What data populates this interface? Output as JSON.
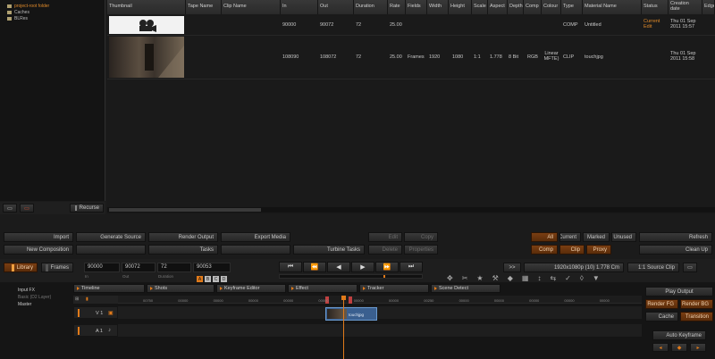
{
  "tree": {
    "items": [
      "project-root folder",
      "Caches",
      "BLRes"
    ]
  },
  "browser": {
    "columns": [
      "Thumbnail",
      "Tape Name",
      "Clip Name",
      "In",
      "Out",
      "Duration",
      "Rate",
      "Fields",
      "Width",
      "Height",
      "Scale",
      "Aspect",
      "Depth",
      "Comp",
      "Colour",
      "Type",
      "Material Name",
      "Status",
      "Creation date",
      "Edge"
    ],
    "rows": [
      {
        "in": "90000",
        "out": "90072",
        "duration": "72",
        "rate": "25.00",
        "fields": "",
        "width": "",
        "height": "",
        "scale": "",
        "aspect": "",
        "depth": "",
        "comp": "",
        "colour": "",
        "type": "COMP",
        "material": "Untitled",
        "status": "Current Edit",
        "created": "Thu 01 Sep 2011 15:57"
      },
      {
        "in": "108090",
        "out": "108072",
        "duration": "72",
        "rate": "25.00",
        "fields": "Frames",
        "width": "1920",
        "height": "1080",
        "scale": "1:1",
        "aspect": "1.778",
        "depth": "8 Bit",
        "comp": "RGB",
        "colour": "Linear MFTE)",
        "type": "CLIP",
        "material": "touchjpg",
        "status": "",
        "created": "Thu 01 Sep 2011 15:58"
      }
    ]
  },
  "tree_buttons": {
    "recurse": "Recurse"
  },
  "actions": {
    "import": "Import",
    "generate_source": "Generate Source",
    "render_output": "Render Output",
    "export_media": "Export Media",
    "new_composition": "New Composition",
    "tasks": "Tasks",
    "turbine_tasks": "Turbine Tasks",
    "edit": "Edit",
    "copy": "Copy",
    "delete": "Delete",
    "properties": "Properties",
    "all": "All",
    "current": "Current",
    "marked": "Marked",
    "unused": "Unused",
    "comp": "Comp",
    "clip": "Clip",
    "proxy": "Proxy",
    "refresh": "Refresh",
    "clean_up": "Clean Up"
  },
  "transport_bar": {
    "library": "Library",
    "frames": "Frames",
    "in_value": "90000",
    "out_value": "90072",
    "duration_value": "72",
    "position_value": "90053",
    "in_label": "In",
    "out_label": "Out",
    "duration_label": "Duration",
    "expand": ">>",
    "format": "1920x1080p (10) 1.778 Cm",
    "source_clip": "1:1 Source Clip",
    "icons": [
      "skip-start-icon",
      "step-back-icon",
      "play-reverse-icon",
      "play-icon",
      "step-forward-icon",
      "skip-end-icon"
    ],
    "icon_glyphs": [
      "⏮",
      "⏪",
      "◀",
      "▶",
      "⏩",
      "⏭"
    ]
  },
  "left_panel": {
    "items": [
      "Input FX",
      "Basic (D2 Layer)",
      "Master"
    ]
  },
  "tabs": [
    "Timeline",
    "Shots",
    "Keyframe Editor",
    "Effect",
    "Tracker",
    "Scene Detect"
  ],
  "layer_badges": [
    "A",
    "B",
    "C",
    "D"
  ],
  "timeline": {
    "ticks": [
      "00750",
      "00000",
      "00000",
      "00000",
      "00000",
      "00000",
      "00000",
      "00000",
      "00250",
      "00000",
      "00000",
      "00000",
      "00000",
      "00000"
    ],
    "track_labels": [
      "V 1",
      "A 1"
    ],
    "clip_label": "touchjpg",
    "playhead_fraction": 0.43
  },
  "right_panel": {
    "play_output": "Play Output",
    "render_fg": "Render FG",
    "render_bg": "Render BG",
    "cache": "Cache",
    "transition": "Transition",
    "auto_keyframe": "Auto Keyframe"
  },
  "colors": {
    "accent": "#e07a1a",
    "orange_button": "#6b350e",
    "bg": "#1b1b1b"
  }
}
